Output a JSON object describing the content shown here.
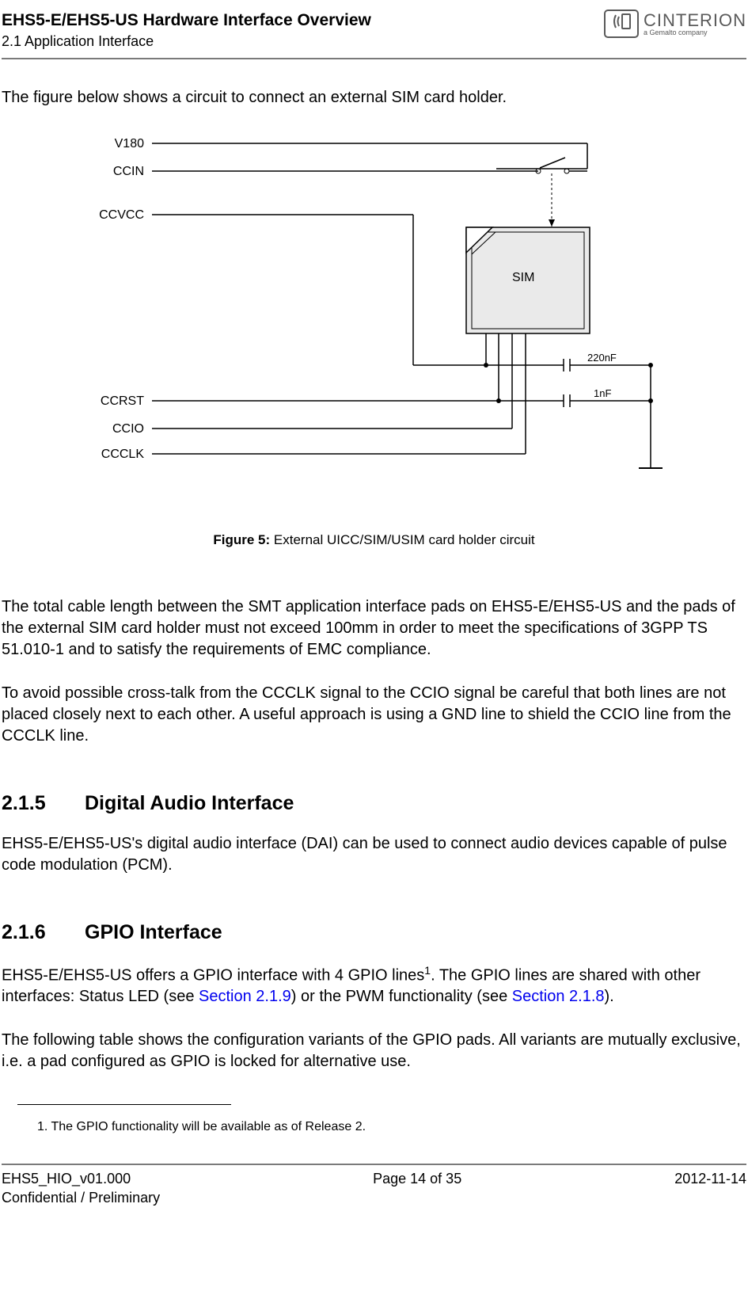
{
  "header": {
    "title": "EHS5-E/EHS5-US Hardware Interface Overview",
    "subtitle": "2.1 Application Interface",
    "logo_brand": "CINTERION",
    "logo_tag": "a Gemalto company"
  },
  "intro": "The figure below shows a circuit to connect an external SIM card holder.",
  "diagram": {
    "labels": {
      "v180": "V180",
      "ccin": "CCIN",
      "ccvcc": "CCVCC",
      "ccrst": "CCRST",
      "ccio": "CCIO",
      "ccclk": "CCCLK",
      "sim": "SIM",
      "cap1": "220nF",
      "cap2": "1nF"
    }
  },
  "figure_caption": {
    "bold": "Figure 5:",
    "text": "  External UICC/SIM/USIM card holder circuit"
  },
  "para1": "The total cable length between the SMT application interface pads on EHS5-E/EHS5-US and the pads of the external SIM card holder must not exceed 100mm in order to meet the specifications of 3GPP TS 51.010-1 and to satisfy the requirements of EMC compliance.",
  "para2": "To avoid possible cross-talk from the CCCLK signal to the CCIO signal be careful that both lines are not placed closely next to each other. A useful approach is using a GND line to shield the CCIO line from the CCCLK line.",
  "section_215": {
    "num": "2.1.5",
    "title": "Digital Audio Interface",
    "body": "EHS5-E/EHS5-US's digital audio interface (DAI) can be used to connect audio devices capable of pulse code modulation (PCM)."
  },
  "section_216": {
    "num": "2.1.6",
    "title": "GPIO Interface",
    "body_pre": "EHS5-E/EHS5-US offers a GPIO interface with 4 GPIO lines",
    "body_mid1": ". The GPIO lines are shared with other interfaces: Status LED (see ",
    "link1": "Section 2.1.9",
    "body_mid2": ") or the PWM functionality (see ",
    "link2": "Section 2.1.8",
    "body_end": ").",
    "body2": "The following table shows the configuration variants of the GPIO pads. All variants are mutually exclusive, i.e. a pad configured as GPIO is locked for alternative use."
  },
  "footnote": "1.  The GPIO functionality will be available as of Release 2.",
  "footer": {
    "left_line1": "EHS5_HIO_v01.000",
    "left_line2": "Confidential / Preliminary",
    "center": "Page 14 of 35",
    "right": "2012-11-14"
  }
}
